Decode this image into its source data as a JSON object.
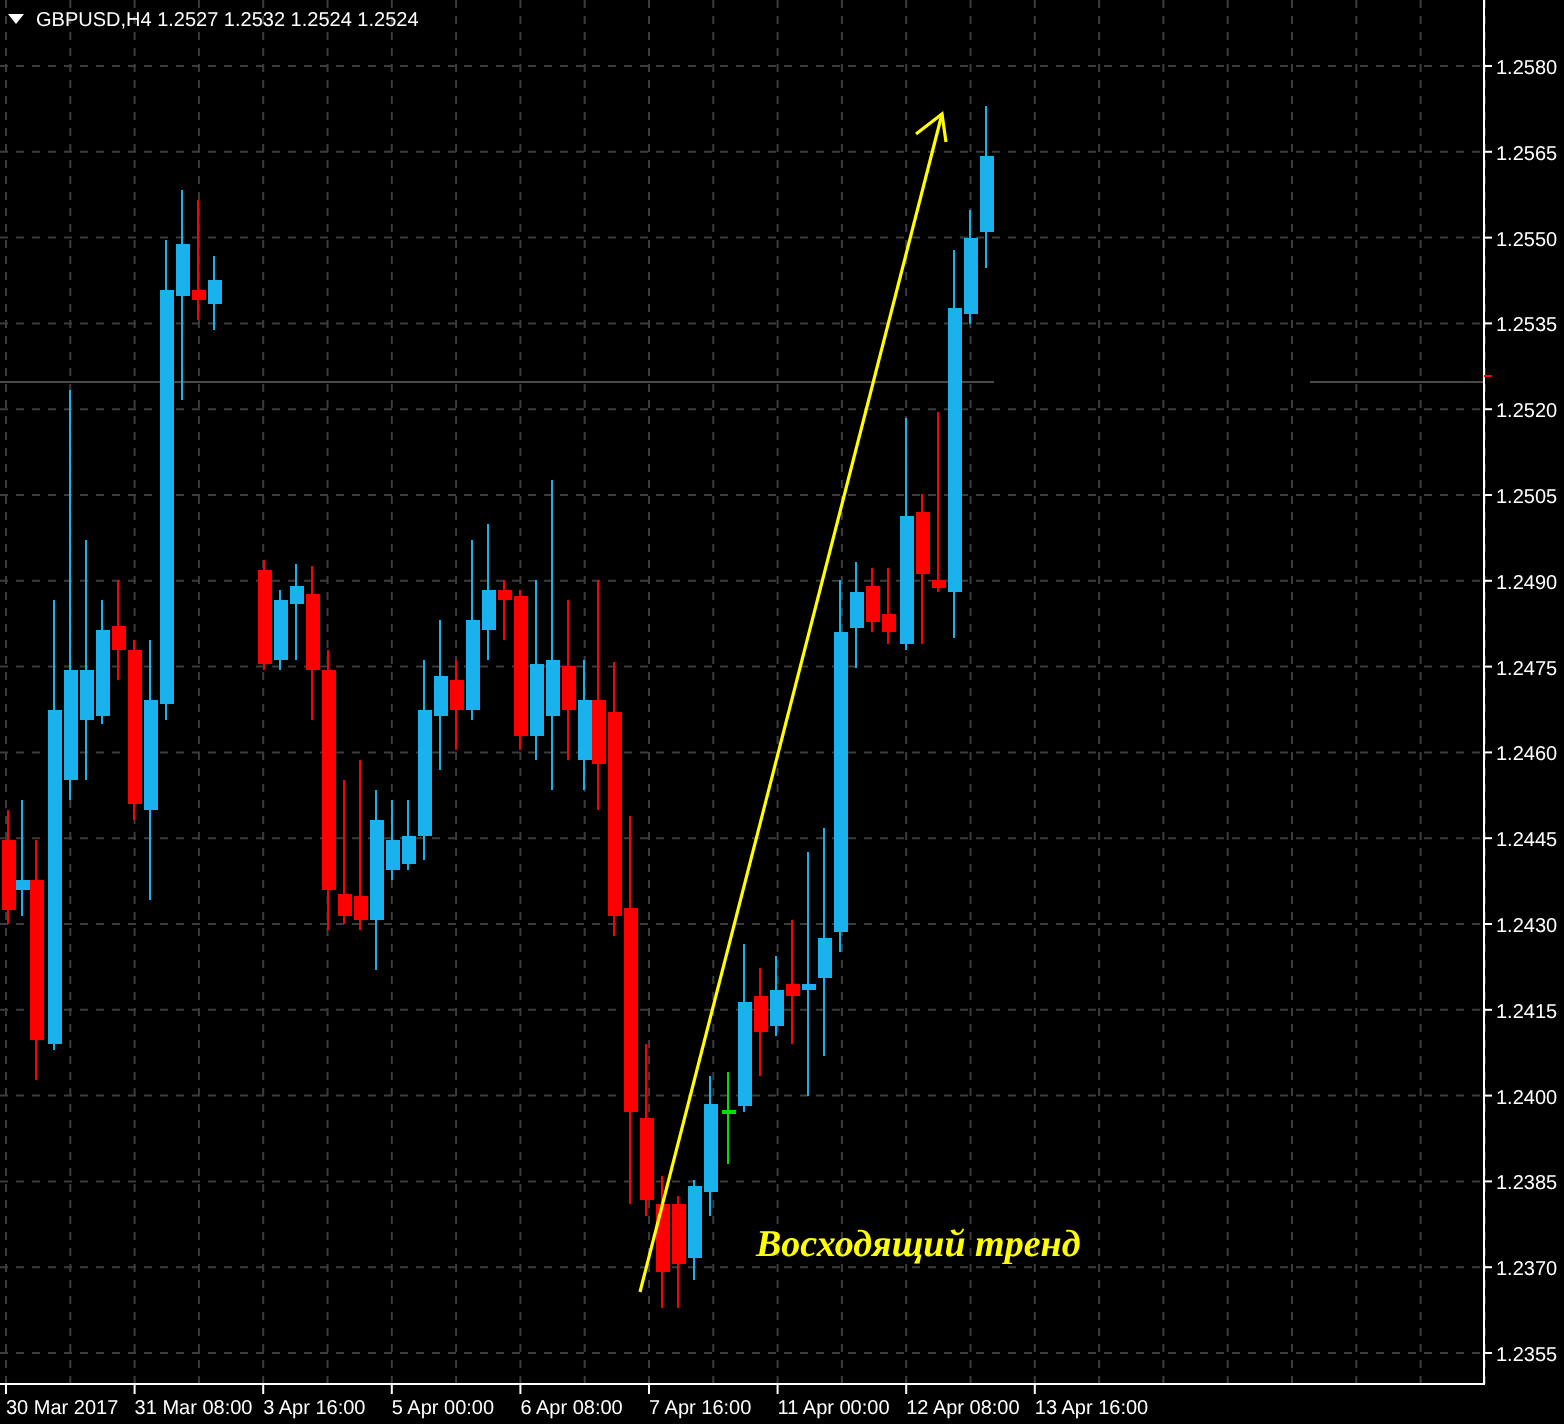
{
  "header": {
    "title": "GBPUSD,H4  1.2527 1.2532 1.2524 1.2524"
  },
  "chart": {
    "annotation": "Восходящий тренд",
    "price_axis": [
      "1.2580",
      "1.2565",
      "1.2550",
      "1.2535",
      "1.2520",
      "1.2505",
      "1.2490",
      "1.2475",
      "1.2460",
      "1.2445",
      "1.2430",
      "1.2415",
      "1.2400",
      "1.2385",
      "1.2370",
      "1.2355"
    ],
    "time_axis": [
      "30 Mar 2017",
      "31 Mar 08:00",
      "3 Apr 16:00",
      "5 Apr 00:00",
      "6 Apr 08:00",
      "7 Apr 16:00",
      "11 Apr 00:00",
      "12 Apr 08:00",
      "13 Apr 16:00"
    ]
  }
}
